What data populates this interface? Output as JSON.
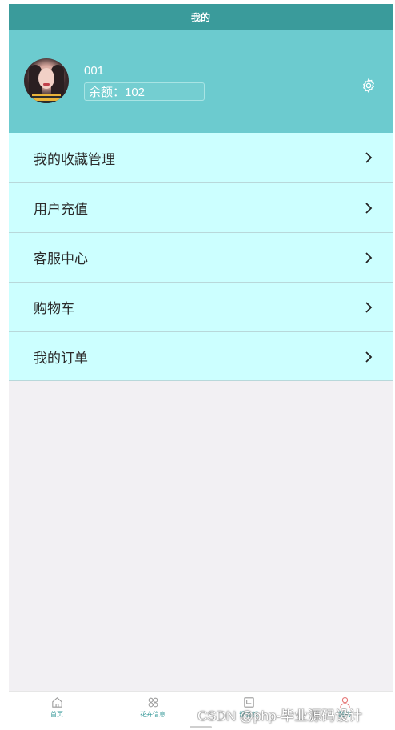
{
  "nav": {
    "title": "我的"
  },
  "profile": {
    "username": "001",
    "balance": "余额：102"
  },
  "menu": {
    "items": [
      {
        "label": "我的收藏管理"
      },
      {
        "label": "用户充值"
      },
      {
        "label": "客服中心"
      },
      {
        "label": "购物车"
      },
      {
        "label": "我的订单"
      }
    ]
  },
  "tabbar": {
    "tabs": [
      {
        "label": "首页",
        "icon": "home-icon"
      },
      {
        "label": "花卉信息",
        "icon": "flower-icon"
      },
      {
        "label": "留言板",
        "icon": "message-board-icon"
      },
      {
        "label": "我的",
        "icon": "user-icon"
      }
    ]
  },
  "watermark": {
    "text": "CSDN @php-毕业源码设计"
  },
  "colors": {
    "header": "#3a9b9b",
    "profile_bg": "#6ccbcf",
    "menu_bg": "#ccffff",
    "page_bg": "#f2f0f3",
    "active_tab_icon": "#e57373"
  }
}
